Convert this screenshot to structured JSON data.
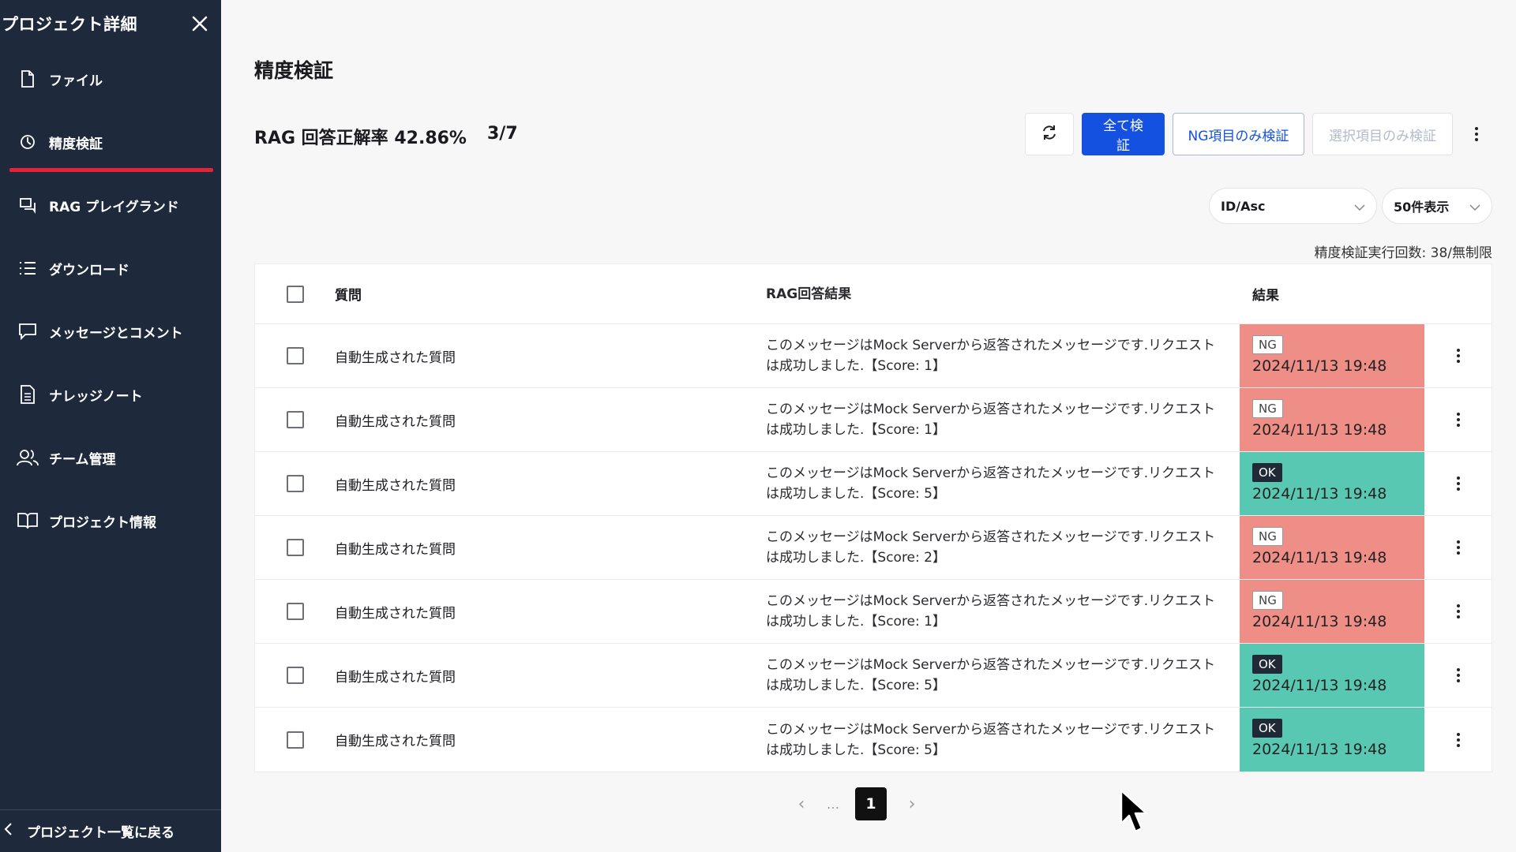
{
  "sidebar": {
    "title": "プロジェクト詳細",
    "items": [
      {
        "label": "ファイル",
        "icon": "file-icon"
      },
      {
        "label": "精度検証",
        "icon": "accuracy-icon"
      },
      {
        "label": "RAG プレイグランド",
        "icon": "chat-icon"
      },
      {
        "label": "ダウンロード",
        "icon": "list-icon"
      },
      {
        "label": "メッセージとコメント",
        "icon": "message-icon"
      },
      {
        "label": "ナレッジノート",
        "icon": "document-icon"
      },
      {
        "label": "チーム管理",
        "icon": "team-icon"
      },
      {
        "label": "プロジェクト情報",
        "icon": "book-icon"
      }
    ],
    "active_index": 1,
    "back_label": "プロジェクト一覧に戻る"
  },
  "main": {
    "title": "精度検証",
    "accuracy_text": "RAG 回答正解率 42.86%",
    "accuracy_count": "3/7",
    "buttons": {
      "verify_all": "全て検証",
      "verify_ng": "NG項目のみ検証",
      "verify_selected": "選択項目のみ検証"
    },
    "sort_select": "ID/Asc",
    "page_size_select": "50件表示",
    "exec_count": "精度検証実行回数: 38/無制限",
    "columns": {
      "question": "質問",
      "answer": "RAG回答結果",
      "result": "結果"
    },
    "rows": [
      {
        "question": "自動生成された質問",
        "answer": "このメッセージはMock Serverから返答されたメッセージです.リクエストは成功しました.【Score: 1】",
        "result": "NG",
        "timestamp": "2024/11/13 19:48"
      },
      {
        "question": "自動生成された質問",
        "answer": "このメッセージはMock Serverから返答されたメッセージです.リクエストは成功しました.【Score: 1】",
        "result": "NG",
        "timestamp": "2024/11/13 19:48"
      },
      {
        "question": "自動生成された質問",
        "answer": "このメッセージはMock Serverから返答されたメッセージです.リクエストは成功しました.【Score: 5】",
        "result": "OK",
        "timestamp": "2024/11/13 19:48"
      },
      {
        "question": "自動生成された質問",
        "answer": "このメッセージはMock Serverから返答されたメッセージです.リクエストは成功しました.【Score: 2】",
        "result": "NG",
        "timestamp": "2024/11/13 19:48"
      },
      {
        "question": "自動生成された質問",
        "answer": "このメッセージはMock Serverから返答されたメッセージです.リクエストは成功しました.【Score: 1】",
        "result": "NG",
        "timestamp": "2024/11/13 19:48"
      },
      {
        "question": "自動生成された質問",
        "answer": "このメッセージはMock Serverから返答されたメッセージです.リクエストは成功しました.【Score: 5】",
        "result": "OK",
        "timestamp": "2024/11/13 19:48"
      },
      {
        "question": "自動生成された質問",
        "answer": "このメッセージはMock Serverから返答されたメッセージです.リクエストは成功しました.【Score: 5】",
        "result": "OK",
        "timestamp": "2024/11/13 19:48"
      }
    ],
    "pagination": {
      "ellipsis": "…",
      "current": "1"
    }
  },
  "colors": {
    "sidebar_bg": "#1e2a3c",
    "accent_red": "#e8213a",
    "primary_blue": "#1451e0",
    "ng_bg": "#ee8e87",
    "ok_bg": "#59c8b3"
  }
}
